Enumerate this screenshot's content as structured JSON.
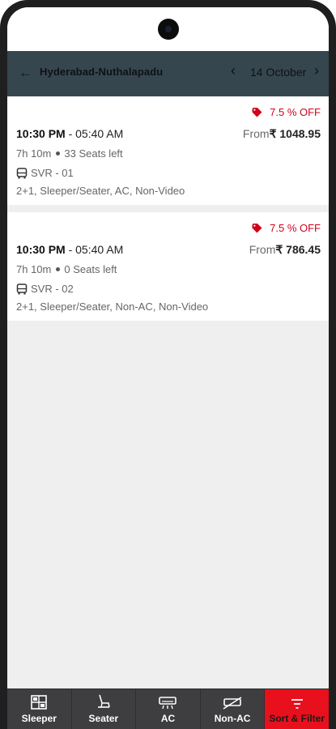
{
  "header": {
    "back_glyph": "←",
    "route": "Hyderabad-Nuthalapadu",
    "prev_glyph": "‹",
    "date": "14 October",
    "next_glyph": "›"
  },
  "results": [
    {
      "offer": "7.5 % OFF",
      "depart": "10:30 PM",
      "arrive": " - 05:40 AM",
      "price_prefix": "From",
      "price": "₹ 1048.95",
      "duration": "7h 10m",
      "seats": "33 Seats left",
      "operator": "SVR - 01",
      "amenities": "2+1, Sleeper/Seater, AC, Non-Video"
    },
    {
      "offer": "7.5 % OFF",
      "depart": "10:30 PM",
      "arrive": " - 05:40 AM",
      "price_prefix": "From",
      "price": "₹ 786.45",
      "duration": "7h 10m",
      "seats": "0 Seats left",
      "operator": "SVR - 02",
      "amenities": "2+1, Sleeper/Seater, Non-AC, Non-Video"
    }
  ],
  "bottom_bar": {
    "tabs": [
      {
        "label": "Sleeper",
        "icon": "sleeper-icon"
      },
      {
        "label": "Seater",
        "icon": "seater-icon"
      },
      {
        "label": "AC",
        "icon": "ac-icon"
      },
      {
        "label": "Non-AC",
        "icon": "non-ac-icon"
      },
      {
        "label": "Sort & Filter",
        "icon": "filter-icon"
      }
    ],
    "active_color": "#e8101c"
  },
  "colors": {
    "header_bg": "#36464f",
    "offer": "#d0021b"
  }
}
